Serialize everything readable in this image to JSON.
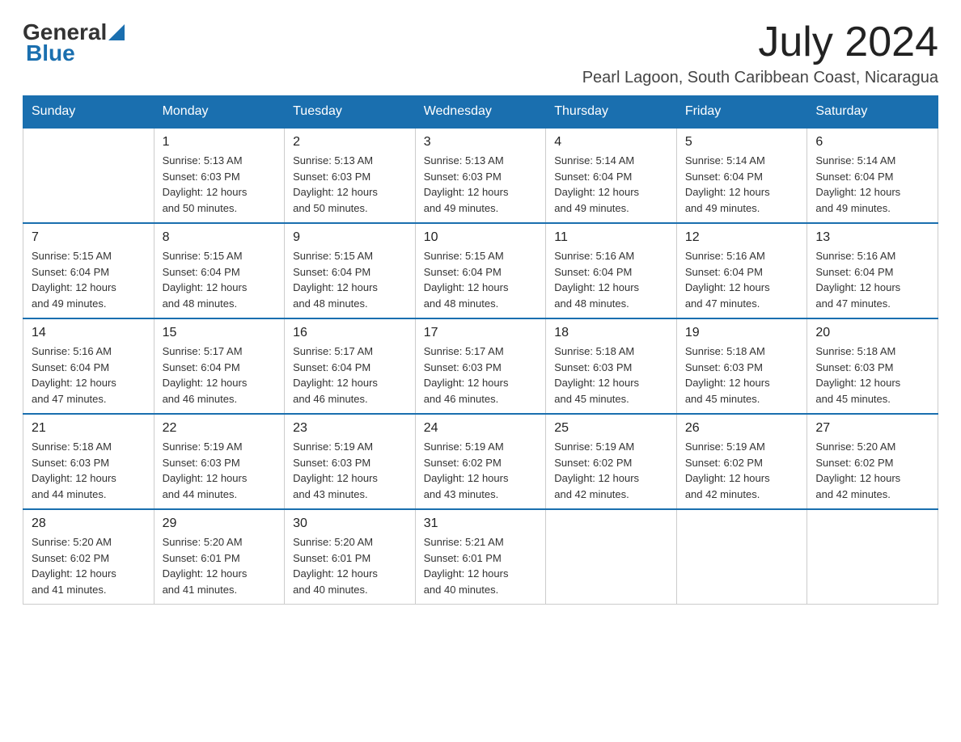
{
  "logo": {
    "text_general": "General",
    "text_blue": "Blue"
  },
  "header": {
    "month_year": "July 2024",
    "location": "Pearl Lagoon, South Caribbean Coast, Nicaragua"
  },
  "days_of_week": [
    "Sunday",
    "Monday",
    "Tuesday",
    "Wednesday",
    "Thursday",
    "Friday",
    "Saturday"
  ],
  "weeks": [
    [
      {
        "day": "",
        "info": ""
      },
      {
        "day": "1",
        "info": "Sunrise: 5:13 AM\nSunset: 6:03 PM\nDaylight: 12 hours\nand 50 minutes."
      },
      {
        "day": "2",
        "info": "Sunrise: 5:13 AM\nSunset: 6:03 PM\nDaylight: 12 hours\nand 50 minutes."
      },
      {
        "day": "3",
        "info": "Sunrise: 5:13 AM\nSunset: 6:03 PM\nDaylight: 12 hours\nand 49 minutes."
      },
      {
        "day": "4",
        "info": "Sunrise: 5:14 AM\nSunset: 6:04 PM\nDaylight: 12 hours\nand 49 minutes."
      },
      {
        "day": "5",
        "info": "Sunrise: 5:14 AM\nSunset: 6:04 PM\nDaylight: 12 hours\nand 49 minutes."
      },
      {
        "day": "6",
        "info": "Sunrise: 5:14 AM\nSunset: 6:04 PM\nDaylight: 12 hours\nand 49 minutes."
      }
    ],
    [
      {
        "day": "7",
        "info": "Sunrise: 5:15 AM\nSunset: 6:04 PM\nDaylight: 12 hours\nand 49 minutes."
      },
      {
        "day": "8",
        "info": "Sunrise: 5:15 AM\nSunset: 6:04 PM\nDaylight: 12 hours\nand 48 minutes."
      },
      {
        "day": "9",
        "info": "Sunrise: 5:15 AM\nSunset: 6:04 PM\nDaylight: 12 hours\nand 48 minutes."
      },
      {
        "day": "10",
        "info": "Sunrise: 5:15 AM\nSunset: 6:04 PM\nDaylight: 12 hours\nand 48 minutes."
      },
      {
        "day": "11",
        "info": "Sunrise: 5:16 AM\nSunset: 6:04 PM\nDaylight: 12 hours\nand 48 minutes."
      },
      {
        "day": "12",
        "info": "Sunrise: 5:16 AM\nSunset: 6:04 PM\nDaylight: 12 hours\nand 47 minutes."
      },
      {
        "day": "13",
        "info": "Sunrise: 5:16 AM\nSunset: 6:04 PM\nDaylight: 12 hours\nand 47 minutes."
      }
    ],
    [
      {
        "day": "14",
        "info": "Sunrise: 5:16 AM\nSunset: 6:04 PM\nDaylight: 12 hours\nand 47 minutes."
      },
      {
        "day": "15",
        "info": "Sunrise: 5:17 AM\nSunset: 6:04 PM\nDaylight: 12 hours\nand 46 minutes."
      },
      {
        "day": "16",
        "info": "Sunrise: 5:17 AM\nSunset: 6:04 PM\nDaylight: 12 hours\nand 46 minutes."
      },
      {
        "day": "17",
        "info": "Sunrise: 5:17 AM\nSunset: 6:03 PM\nDaylight: 12 hours\nand 46 minutes."
      },
      {
        "day": "18",
        "info": "Sunrise: 5:18 AM\nSunset: 6:03 PM\nDaylight: 12 hours\nand 45 minutes."
      },
      {
        "day": "19",
        "info": "Sunrise: 5:18 AM\nSunset: 6:03 PM\nDaylight: 12 hours\nand 45 minutes."
      },
      {
        "day": "20",
        "info": "Sunrise: 5:18 AM\nSunset: 6:03 PM\nDaylight: 12 hours\nand 45 minutes."
      }
    ],
    [
      {
        "day": "21",
        "info": "Sunrise: 5:18 AM\nSunset: 6:03 PM\nDaylight: 12 hours\nand 44 minutes."
      },
      {
        "day": "22",
        "info": "Sunrise: 5:19 AM\nSunset: 6:03 PM\nDaylight: 12 hours\nand 44 minutes."
      },
      {
        "day": "23",
        "info": "Sunrise: 5:19 AM\nSunset: 6:03 PM\nDaylight: 12 hours\nand 43 minutes."
      },
      {
        "day": "24",
        "info": "Sunrise: 5:19 AM\nSunset: 6:02 PM\nDaylight: 12 hours\nand 43 minutes."
      },
      {
        "day": "25",
        "info": "Sunrise: 5:19 AM\nSunset: 6:02 PM\nDaylight: 12 hours\nand 42 minutes."
      },
      {
        "day": "26",
        "info": "Sunrise: 5:19 AM\nSunset: 6:02 PM\nDaylight: 12 hours\nand 42 minutes."
      },
      {
        "day": "27",
        "info": "Sunrise: 5:20 AM\nSunset: 6:02 PM\nDaylight: 12 hours\nand 42 minutes."
      }
    ],
    [
      {
        "day": "28",
        "info": "Sunrise: 5:20 AM\nSunset: 6:02 PM\nDaylight: 12 hours\nand 41 minutes."
      },
      {
        "day": "29",
        "info": "Sunrise: 5:20 AM\nSunset: 6:01 PM\nDaylight: 12 hours\nand 41 minutes."
      },
      {
        "day": "30",
        "info": "Sunrise: 5:20 AM\nSunset: 6:01 PM\nDaylight: 12 hours\nand 40 minutes."
      },
      {
        "day": "31",
        "info": "Sunrise: 5:21 AM\nSunset: 6:01 PM\nDaylight: 12 hours\nand 40 minutes."
      },
      {
        "day": "",
        "info": ""
      },
      {
        "day": "",
        "info": ""
      },
      {
        "day": "",
        "info": ""
      }
    ]
  ]
}
